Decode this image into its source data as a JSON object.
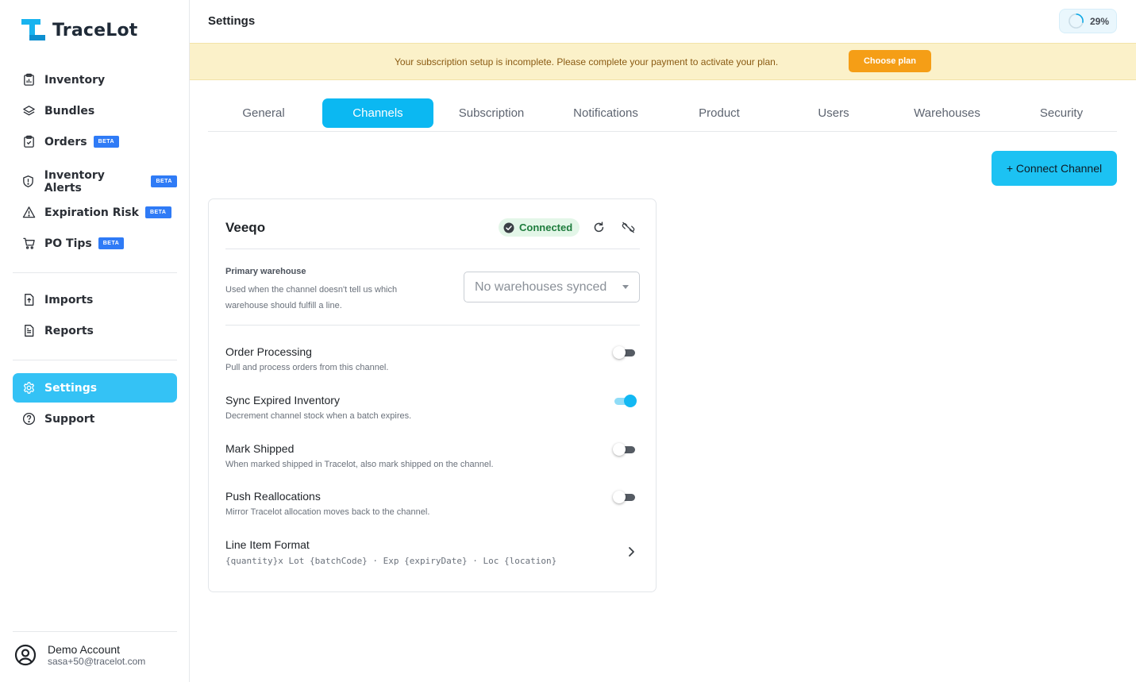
{
  "app": {
    "name": "TraceLot"
  },
  "sidebar": {
    "items": [
      {
        "label": "Inventory",
        "icon": "inventory-icon"
      },
      {
        "label": "Bundles",
        "icon": "layers-icon"
      },
      {
        "label": "Orders",
        "icon": "clipboard-icon",
        "badge": "BETA"
      },
      {
        "label": "Inventory Alerts",
        "icon": "shield-alert-icon",
        "badge": "BETA"
      },
      {
        "label": "Expiration Risk",
        "icon": "warning-icon",
        "badge": "BETA"
      },
      {
        "label": "PO Tips",
        "icon": "cart-icon",
        "badge": "BETA"
      },
      {
        "label": "Imports",
        "icon": "file-upload-icon"
      },
      {
        "label": "Reports",
        "icon": "file-text-icon"
      },
      {
        "label": "Settings",
        "icon": "gear-icon",
        "active": true
      },
      {
        "label": "Support",
        "icon": "help-circle-icon"
      }
    ],
    "account": {
      "name": "Demo Account",
      "email": "sasa+50@tracelot.com"
    }
  },
  "header": {
    "title": "Settings",
    "progress": {
      "label": "29%",
      "value": 0.29
    }
  },
  "banner": {
    "message": "Your subscription setup is incomplete. Please complete your payment to activate your plan.",
    "button": "Choose plan"
  },
  "tabs": [
    {
      "label": "General"
    },
    {
      "label": "Channels",
      "active": true
    },
    {
      "label": "Subscription"
    },
    {
      "label": "Notifications"
    },
    {
      "label": "Product"
    },
    {
      "label": "Users"
    },
    {
      "label": "Warehouses"
    },
    {
      "label": "Security"
    }
  ],
  "connect_button": "+ Connect Channel",
  "channel": {
    "name": "Veeqo",
    "status": "Connected",
    "primary_warehouse": {
      "label": "Primary warehouse",
      "description": "Used when the channel doesn't tell us which warehouse should fulfill a line.",
      "selected": "No warehouses synced"
    },
    "settings": [
      {
        "title": "Order Processing",
        "description": "Pull and process orders from this channel.",
        "enabled": false
      },
      {
        "title": "Sync Expired Inventory",
        "description": "Decrement channel stock when a batch expires.",
        "enabled": true
      },
      {
        "title": "Mark Shipped",
        "description": "When marked shipped in Tracelot, also mark shipped on the channel.",
        "enabled": false
      },
      {
        "title": "Push Reallocations",
        "description": "Mirror Tracelot allocation moves back to the channel.",
        "enabled": false
      }
    ],
    "line_item_format": {
      "title": "Line Item Format",
      "value": "{quantity}x Lot {batchCode} · Exp {expiryDate} · Loc {location}"
    }
  },
  "colors": {
    "accent": "#34c2f5",
    "tab_active": "#0bb8f2",
    "banner_bg": "#fbf1c9",
    "warning_button": "#f59e16",
    "beta_badge": "#2f7bf6",
    "connected_bg": "#e3f6e8",
    "connected_text": "#1e7c3d"
  }
}
